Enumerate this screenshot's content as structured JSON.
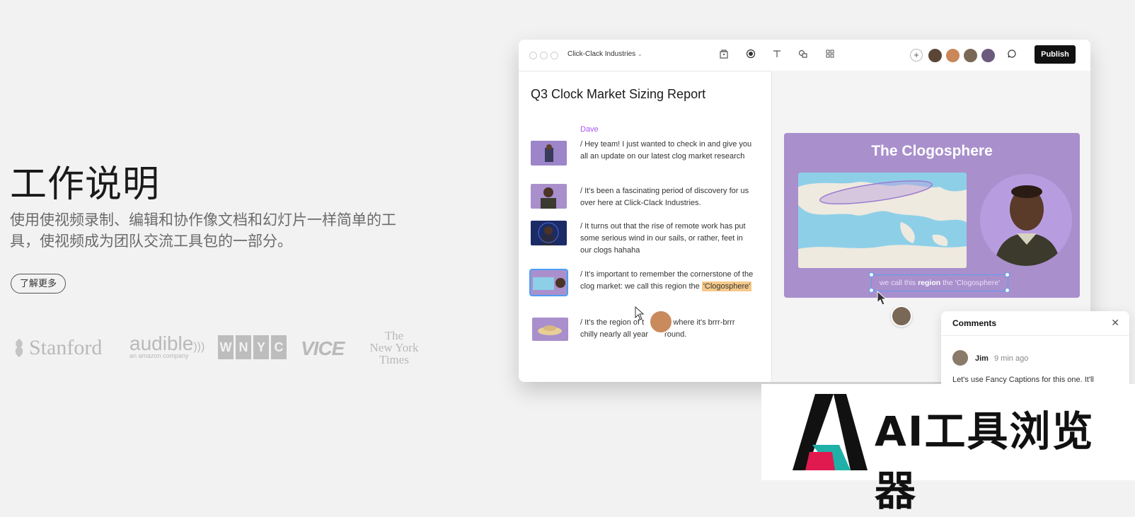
{
  "hero": {
    "title": "工作说明",
    "description": "使用使视频录制、编辑和协作像文档和幻灯片一样简单的工具，使视频成为团队交流工具包的一部分。",
    "learn_more": "了解更多"
  },
  "logos": {
    "stanford": "Stanford",
    "audible": "audible",
    "audible_sub": "an amazon company",
    "wnyc": [
      "W",
      "N",
      "Y",
      "C"
    ],
    "vice": "VICE",
    "nyt": [
      "The",
      "New York",
      "Times"
    ]
  },
  "app": {
    "workspace": "Click-Clack Industries",
    "tools": [
      "storage-icon",
      "record-icon",
      "text-icon",
      "shapes-icon",
      "grid-icon"
    ],
    "publish": "Publish",
    "doc_title": "Q3 Clock Market Sizing Report",
    "speaker": "Dave",
    "script_lines": [
      "/ Hey team! I just wanted to check in and give you all an update on our latest clog market research",
      "/ It's been a fascinating period of discovery for us over here at Click-Clack Industries.",
      "/ It turns out that the rise of remote work has put some serious wind in our sails, or rather, feet in our clogs hahaha",
      "/ It's important to remember the cornerstone of the clog market: we call this region the",
      "/ It's the region of t",
      "rld where it's brrr-brrr",
      "chilly nearly all year",
      "round."
    ],
    "highlight": "'Clogosphere'",
    "slide": {
      "title": "The Clogosphere",
      "caption_pre": "we call this ",
      "caption_bold": "region",
      "caption_post": " the 'Clogosphere'"
    }
  },
  "comments": {
    "header": "Comments",
    "author": "Jim",
    "time": "9 min ago",
    "text": "Let's use Fancy Captions for this one. It'll"
  },
  "watermark": {
    "text": "AI工具浏览器"
  },
  "colors": {
    "accent_purple": "#a855f7",
    "slide_bg": "#a98fcc",
    "highlight": "#f6c98a"
  }
}
